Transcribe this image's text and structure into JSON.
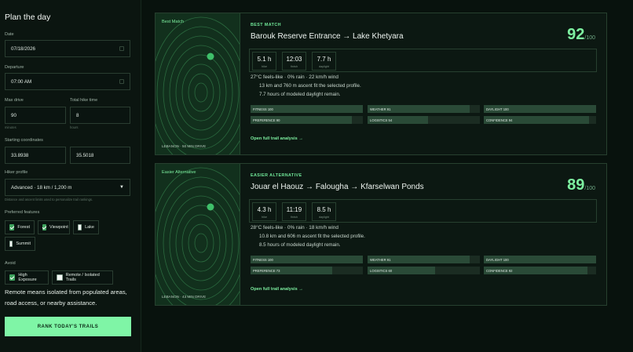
{
  "sidebar": {
    "title": "Plan the day",
    "date_label": "Date",
    "date_value": "07/18/2026",
    "departure_label": "Departure",
    "departure_value": "07:00 AM",
    "max_drive_label": "Max drive",
    "max_drive_value": "90",
    "max_drive_unit": "minutes",
    "total_hike_label": "Total hike time",
    "total_hike_value": "8",
    "total_hike_unit": "hours",
    "coords_label": "Starting coordinates",
    "lat_value": "33.8938",
    "lon_value": "35.5018",
    "profile_label": "Hiker profile",
    "profile_value": "Advanced · 18 km / 1,200 m",
    "profile_hint": "Distance and ascent limits used to personalize trail rankings.",
    "features_label": "Preferred features",
    "features": [
      {
        "label": "Forest",
        "checked": true
      },
      {
        "label": "Viewpoint",
        "checked": true
      },
      {
        "label": "Lake",
        "checked": false
      },
      {
        "label": "Summit",
        "checked": false
      }
    ],
    "avoid_label": "Avoid",
    "avoid": [
      {
        "label": "High Exposure",
        "checked": true
      },
      {
        "label": "Remote / Isolated Trails",
        "checked": false
      }
    ],
    "note": "Remote means isolated from populated areas, road access, or nearby assistance.",
    "rank_button": "RANK TODAY'S TRAILS"
  },
  "cards": [
    {
      "map_tag": "Best Match",
      "map_footer": "LEBANON · 50 MIN DRIVE",
      "context": "BEST MATCH",
      "title": "Barouk Reserve Entrance → Lake Khetyara",
      "score": "92",
      "score_den": "/100",
      "stats": [
        {
          "value": "5.1 h",
          "unit": "hike"
        },
        {
          "value": "12:03",
          "unit": "finish"
        },
        {
          "value": "7.7 h",
          "unit": "daylight"
        }
      ],
      "weather": "27°C feels-like · 0% rain · 22 km/h wind",
      "reason1": "13 km and 760 m ascent fit the selected profile.",
      "reason2": "7.7 hours of modeled daylight remain.",
      "bars": [
        {
          "label": "FITNESS 100",
          "value": 100
        },
        {
          "label": "WEATHER 91",
          "value": 91
        },
        {
          "label": "DAYLIGHT 100",
          "value": 100
        },
        {
          "label": "PREFERENCE 90",
          "value": 90
        },
        {
          "label": "LOGISTICS 54",
          "value": 54
        },
        {
          "label": "CONFIDENCE 94",
          "value": 94
        }
      ],
      "link": "Open full trail analysis →"
    },
    {
      "map_tag": "Easier Alternative",
      "map_footer": "LEBANON · 43 MIN DRIVE",
      "context": "EASIER ALTERNATIVE",
      "title": "Jouar el Haouz → Falougha → Kfarselwan Ponds",
      "score": "89",
      "score_den": "/100",
      "stats": [
        {
          "value": "4.3 h",
          "unit": "hike"
        },
        {
          "value": "11:19",
          "unit": "finish"
        },
        {
          "value": "8.5 h",
          "unit": "daylight"
        }
      ],
      "weather": "28°C feels-like · 0% rain · 18 km/h wind",
      "reason1": "10.8 km and 606 m ascent fit the selected profile.",
      "reason2": "8.5 hours of modeled daylight remain.",
      "bars": [
        {
          "label": "FITNESS 100",
          "value": 100
        },
        {
          "label": "WEATHER 91",
          "value": 91
        },
        {
          "label": "DAYLIGHT 100",
          "value": 100
        },
        {
          "label": "PREFERENCE 73",
          "value": 73
        },
        {
          "label": "LOGISTICS 60",
          "value": 60
        },
        {
          "label": "CONFIDENCE 92",
          "value": 92
        }
      ],
      "link": "Open full trail analysis →"
    }
  ],
  "colors": {
    "accent": "#7df0a0",
    "background": "#08120d",
    "map": "#12301d"
  }
}
